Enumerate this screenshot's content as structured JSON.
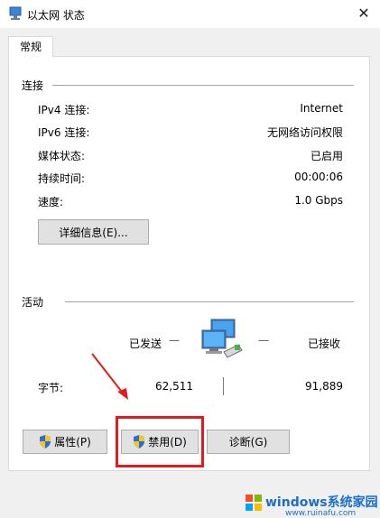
{
  "window": {
    "title": "以太网 状态",
    "close_glyph": "✕"
  },
  "tabs": [
    {
      "label": "常规"
    }
  ],
  "connection": {
    "heading": "连接",
    "rows": [
      {
        "label": "IPv4 连接:",
        "value": "Internet"
      },
      {
        "label": "IPv6 连接:",
        "value": "无网络访问权限"
      },
      {
        "label": "媒体状态:",
        "value": "已启用"
      },
      {
        "label": "持续时间:",
        "value": "00:00:06"
      },
      {
        "label": "速度:",
        "value": "1.0 Gbps"
      }
    ],
    "details_button": "详细信息(E)..."
  },
  "activity": {
    "heading": "活动",
    "sent_label": "已发送",
    "received_label": "已接收",
    "dash": "—",
    "bytes_label": "字节:",
    "bytes_sent": "62,511",
    "bytes_received": "91,889"
  },
  "buttons": {
    "properties": "属性(P)",
    "disable": "禁用(D)",
    "diagnose": "诊断(G)"
  },
  "watermark": {
    "brand": "windows系统家园",
    "url": "www.ruinafu.com"
  },
  "colors": {
    "highlight": "#e31b1b",
    "watermark": "#1a6fc9"
  }
}
